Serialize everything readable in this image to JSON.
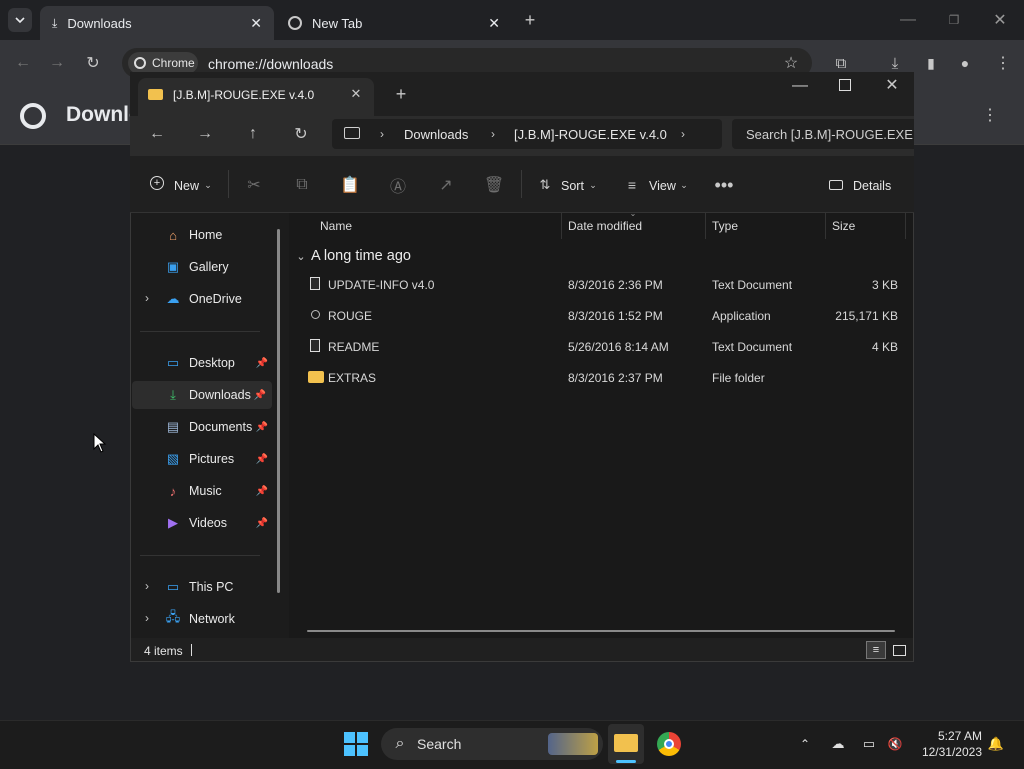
{
  "browser": {
    "tabs": [
      {
        "label": "Downloads"
      },
      {
        "label": "New Tab"
      }
    ],
    "omnibox": {
      "chip": "Chrome",
      "url": "chrome://downloads"
    },
    "page_title": "Downlo"
  },
  "explorer": {
    "tab_title": "[J.B.M]-ROUGE.EXE v.4.0",
    "breadcrumb": [
      "Downloads",
      "[J.B.M]-ROUGE.EXE v.4.0"
    ],
    "search_placeholder": "Search [J.B.M]-ROUGE.EXE v",
    "commands": {
      "new": "New",
      "sort": "Sort",
      "view": "View",
      "details": "Details"
    },
    "sidebar": {
      "home": "Home",
      "gallery": "Gallery",
      "onedrive": "OneDrive",
      "desktop": "Desktop",
      "downloads": "Downloads",
      "documents": "Documents",
      "pictures": "Pictures",
      "music": "Music",
      "videos": "Videos",
      "thispc": "This PC",
      "network": "Network"
    },
    "columns": {
      "name": "Name",
      "date": "Date modified",
      "type": "Type",
      "size": "Size"
    },
    "group": "A long time ago",
    "files": [
      {
        "name": "UPDATE-INFO v4.0",
        "date": "8/3/2016 2:36 PM",
        "type": "Text Document",
        "size": "3 KB"
      },
      {
        "name": "ROUGE",
        "date": "8/3/2016 1:52 PM",
        "type": "Application",
        "size": "215,171 KB"
      },
      {
        "name": "README",
        "date": "5/26/2016 8:14 AM",
        "type": "Text Document",
        "size": "4 KB"
      },
      {
        "name": "EXTRAS",
        "date": "8/3/2016 2:37 PM",
        "type": "File folder",
        "size": ""
      }
    ],
    "status": "4 items"
  },
  "taskbar": {
    "search": "Search",
    "time": "5:27 AM",
    "date": "12/31/2023"
  },
  "colors": {
    "accent": "#0078d4",
    "folder": "#f2c14e"
  }
}
